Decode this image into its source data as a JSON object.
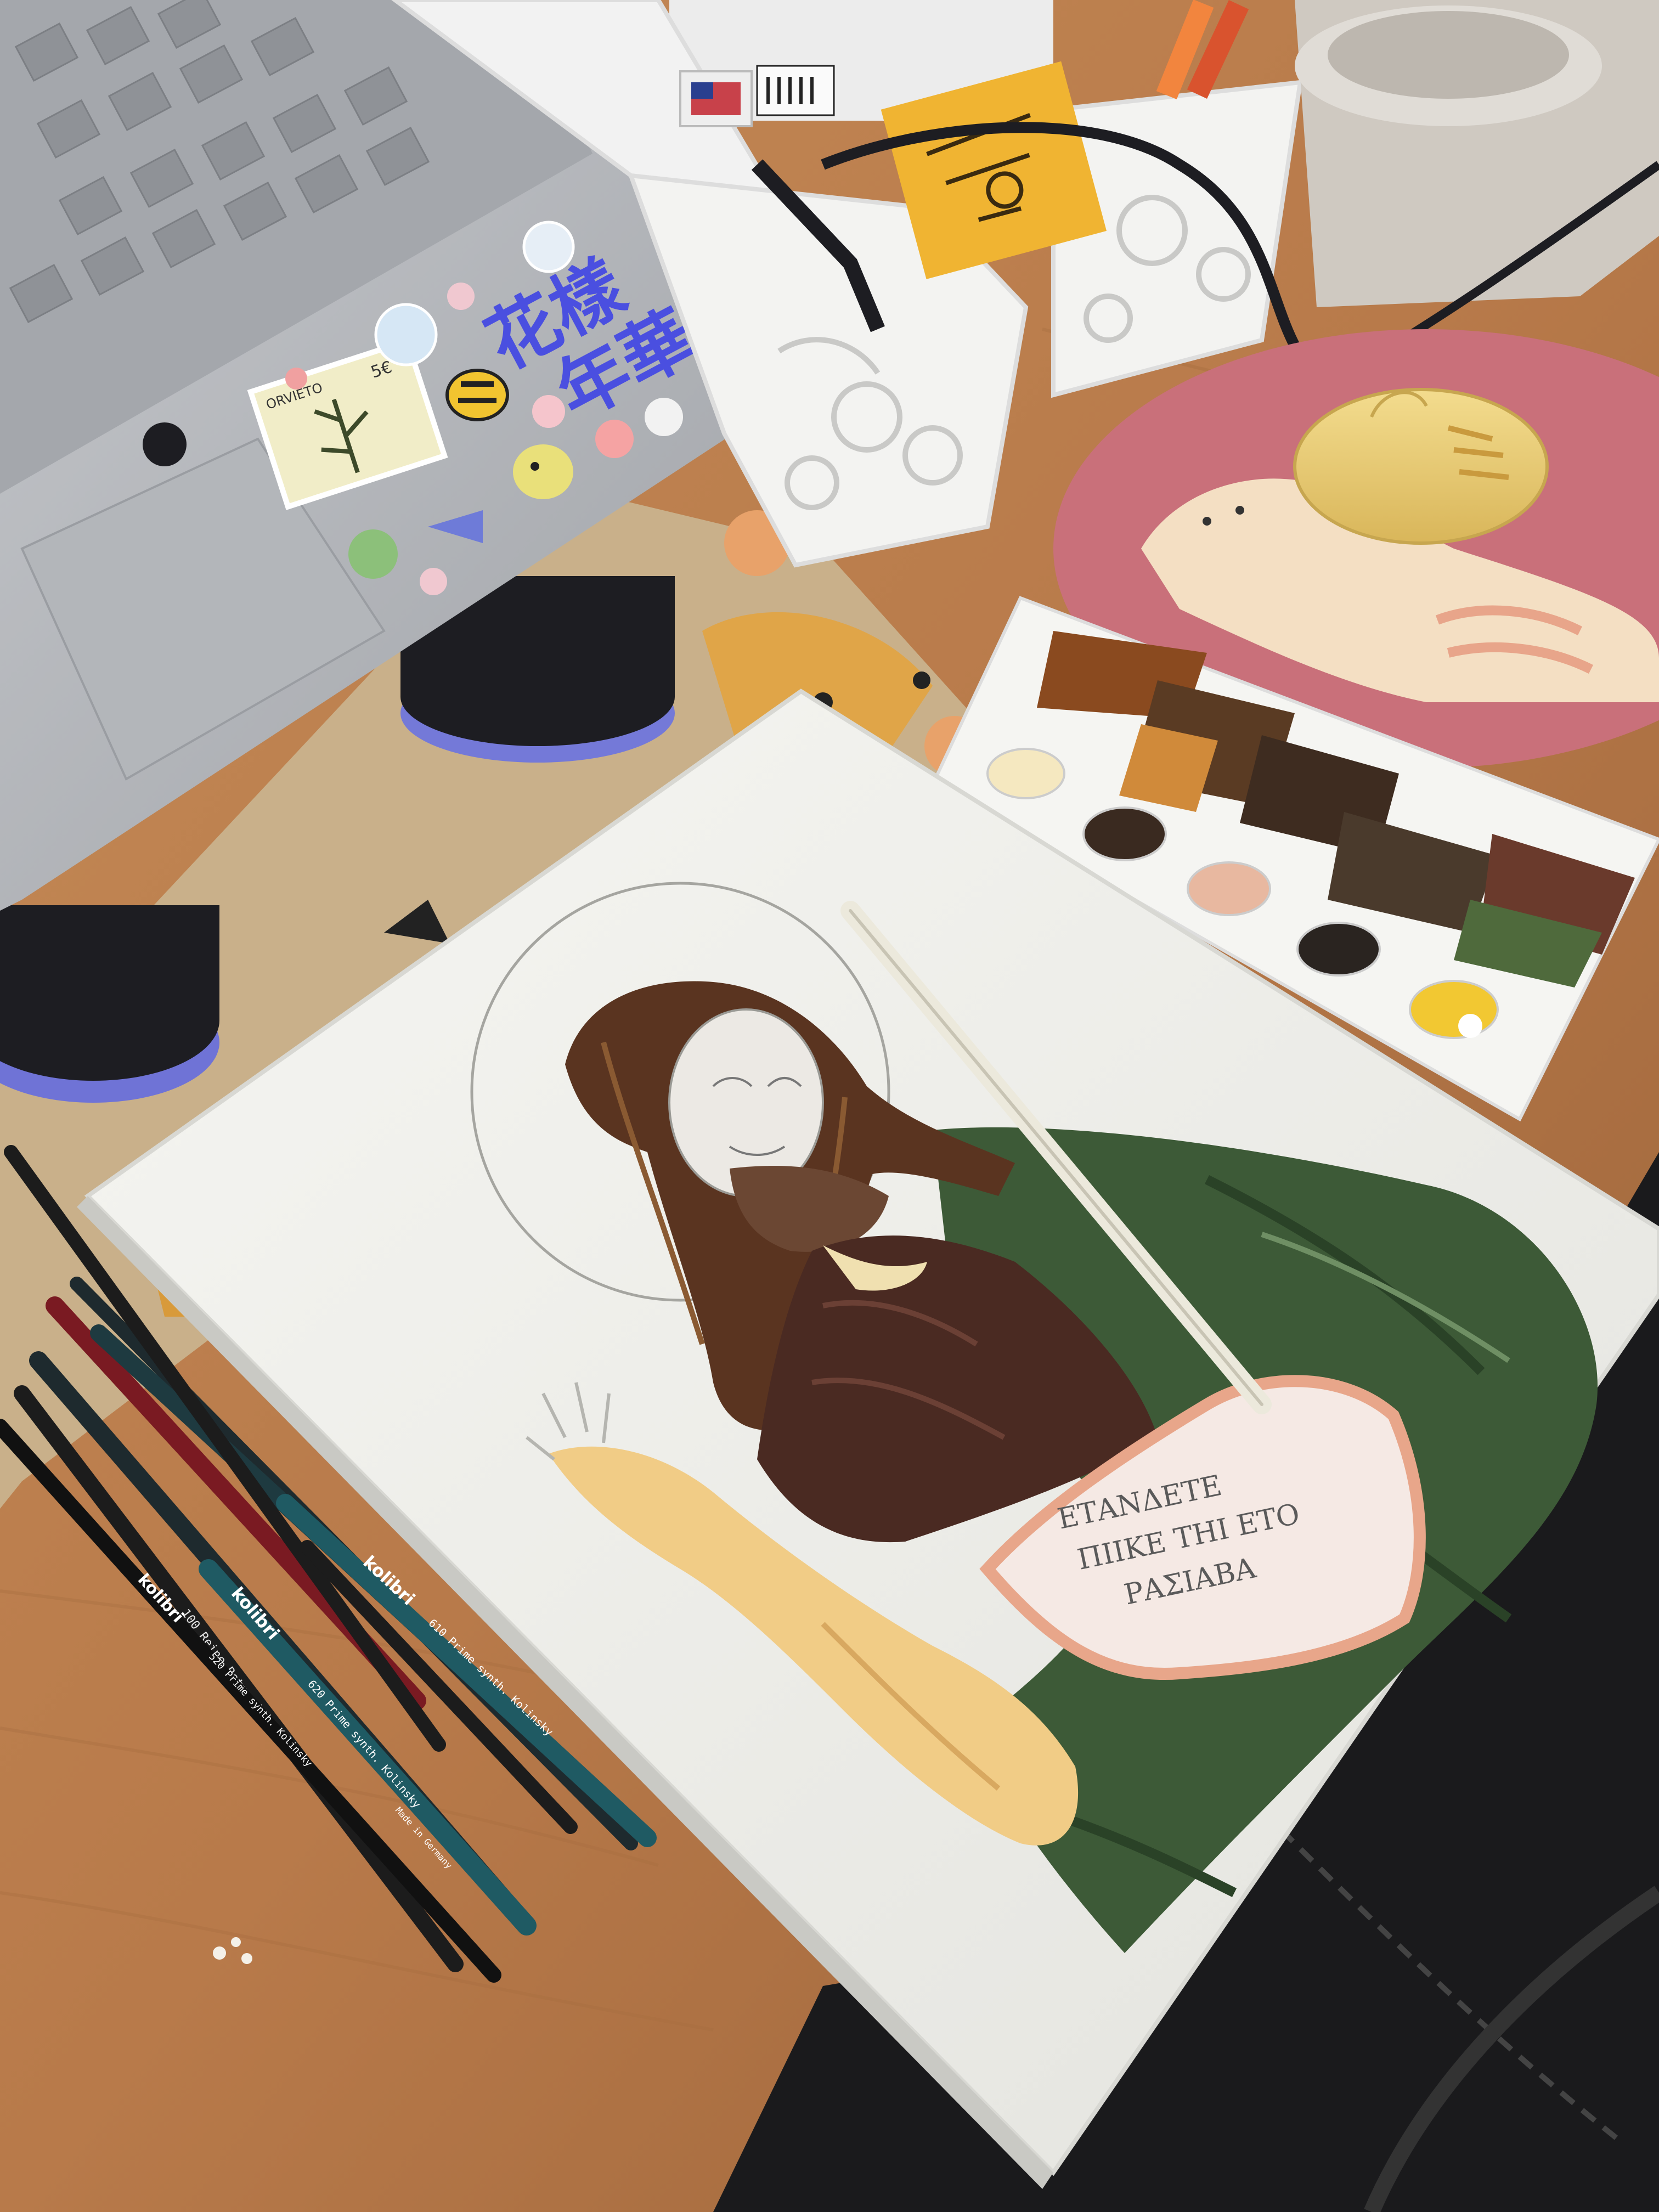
{
  "stickers": {
    "chinese_line1": "花樣",
    "chinese_line2": "年華",
    "stamp_city": "ORVIETO",
    "stamp_value": "5€"
  },
  "brushes": {
    "brand": "kolibri",
    "made_in": "Made in Germany",
    "b1_imprint": "100 Reine Rotmarder",
    "b2_imprint": "620 Prime synth. Kolinsky",
    "b3_imprint": "520 Prime synth. Kolinsky",
    "b4_imprint": "610 Prime synth. Kolinsky"
  },
  "scroll_text": {
    "line1": "ΕΤΑΝΔΕΤΕ",
    "line2": "ΠΙΙΚΕ ΤΗΙ ΕΤΟ",
    "line3": "ΡΑΣΙΑΒΑ"
  },
  "colors": {
    "desk": "#b87a4a",
    "laptop": "#b9bbbf",
    "panel": "#f1f1ee",
    "robe_green": "#3d5a37",
    "hair_brown": "#5a3420",
    "mousepad": "#c9707a",
    "sticky_note": "#f0b432"
  },
  "icons": [
    "laptop-icon",
    "mouse-icon",
    "paint-palette-icon",
    "brush-icon",
    "mousepad-icon"
  ]
}
